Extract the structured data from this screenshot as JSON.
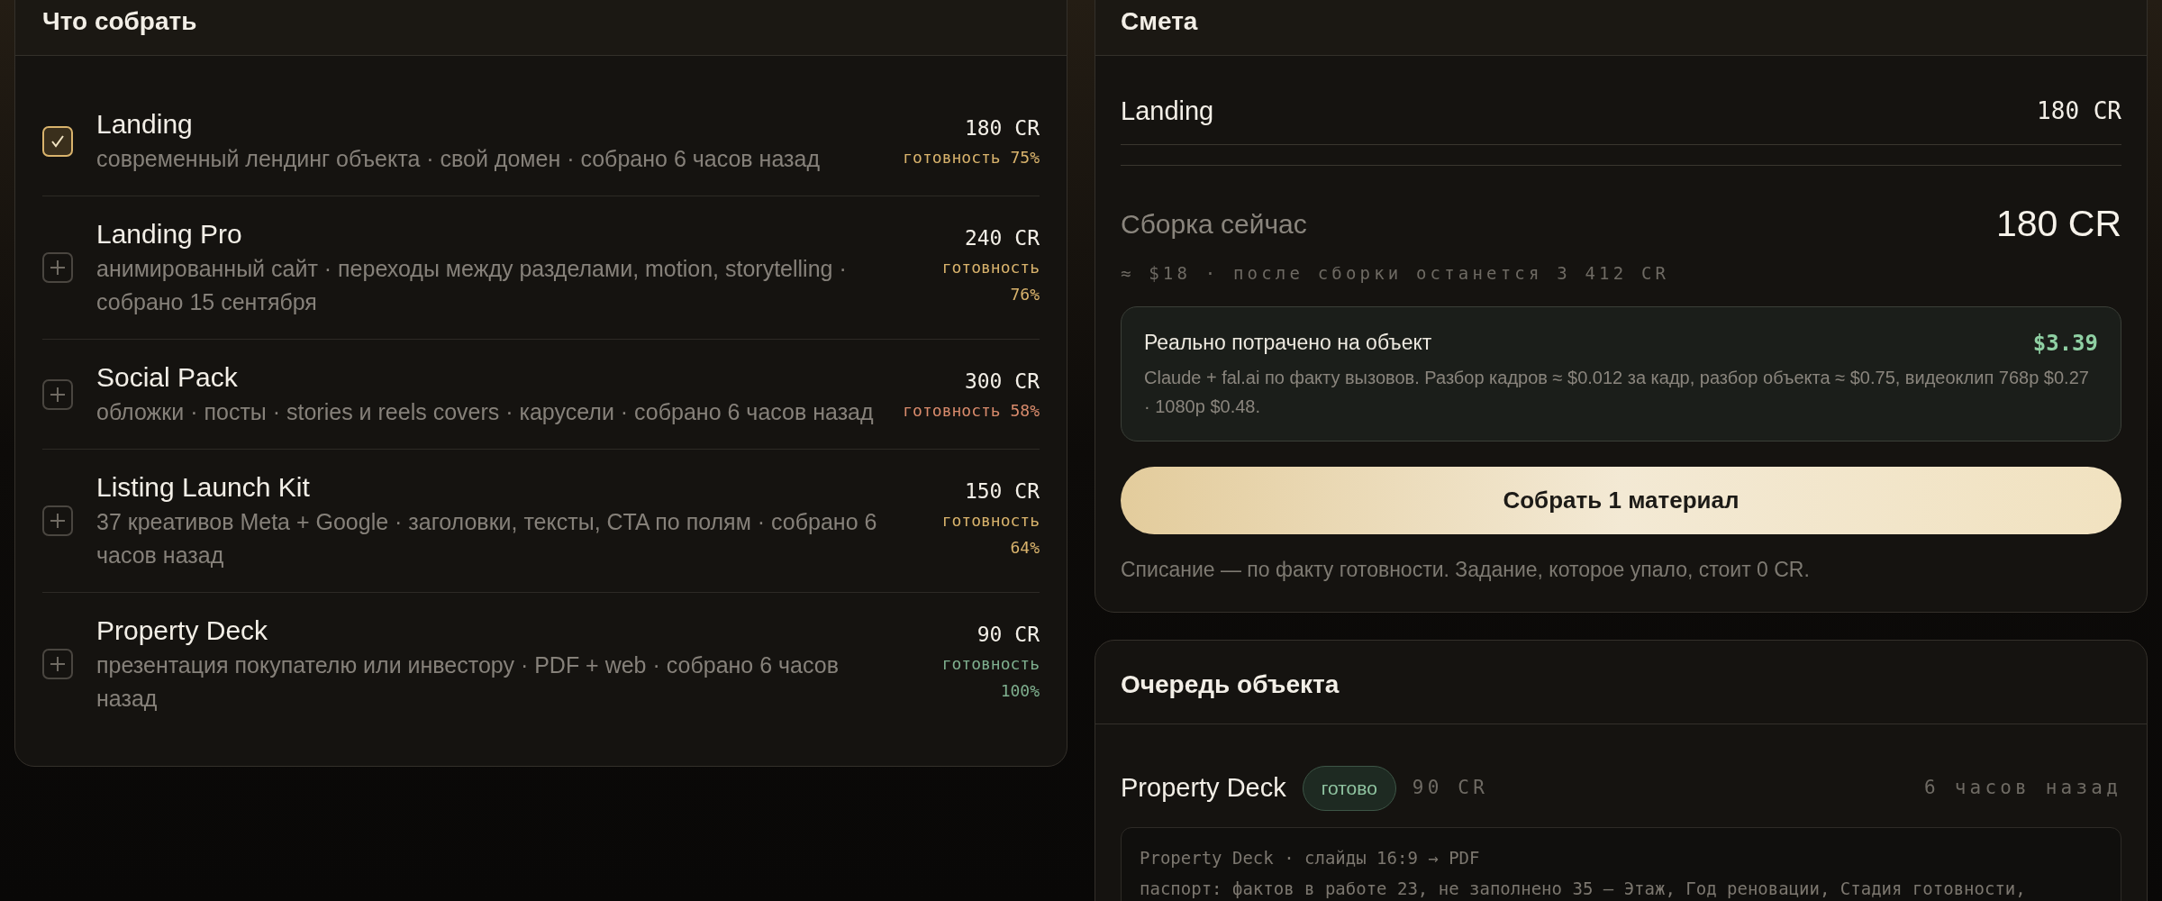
{
  "build_panel": {
    "title": "Что собрать",
    "items": [
      {
        "name": "Landing",
        "description": "современный лендинг объекта · свой домен · собрано 6 часов назад",
        "price": "180 CR",
        "readiness": "готовность 75%",
        "color": "#d9b36c",
        "selected": true
      },
      {
        "name": "Landing Pro",
        "description": "анимированный сайт · переходы между разделами, motion, storytelling · собрано 15 сентября",
        "price": "240 CR",
        "readiness": "готовность 76%",
        "color": "#d9b36c",
        "selected": false
      },
      {
        "name": "Social Pack",
        "description": "обложки · посты · stories и reels covers · карусели · собрано 6 часов назад",
        "price": "300 CR",
        "readiness": "готовность 58%",
        "color": "#d98b6c",
        "selected": false
      },
      {
        "name": "Listing Launch Kit",
        "description": "37 креативов Meta + Google · заголовки, тексты, CTA по полям · собрано 6 часов назад",
        "price": "150 CR",
        "readiness": "готовность 64%",
        "color": "#d9b36c",
        "selected": false
      },
      {
        "name": "Property Deck",
        "description": "презентация покупателю или инвестору · PDF + web · собрано 6 часов назад",
        "price": "90 CR",
        "readiness": "готовность 100%",
        "color": "#7fb08f",
        "selected": false
      }
    ]
  },
  "estimate": {
    "title": "Смета",
    "lines": [
      {
        "name": "Landing",
        "price": "180 CR"
      }
    ],
    "total_label": "Сборка сейчас",
    "total": "180 CR",
    "subline": "≈ $18 · после сборки останется 3 412 CR",
    "spent": {
      "title": "Реально потрачено на объект",
      "amount": "$3.39",
      "note": "Claude + fal.ai по факту вызовов. Разбор кадров ≈ $0.012 за кадр, разбор объекта ≈ $0.75, видеоклип 768p $0.27 · 1080p $0.48."
    },
    "button": "Собрать 1 материал",
    "footnote": "Списание — по факту готовности. Задание, которое упало, стоит 0 CR."
  },
  "queue": {
    "title": "Очередь объекта",
    "jobs": [
      {
        "name": "Property Deck",
        "status": "готово",
        "price": "90 CR",
        "time": "6 часов назад",
        "log": [
          "Property Deck · слайды 16:9 → PDF",
          "паспорт: фактов в работе 23, не заполнено 35 — Этаж, Год реновации, Стадия готовности,"
        ]
      }
    ]
  }
}
